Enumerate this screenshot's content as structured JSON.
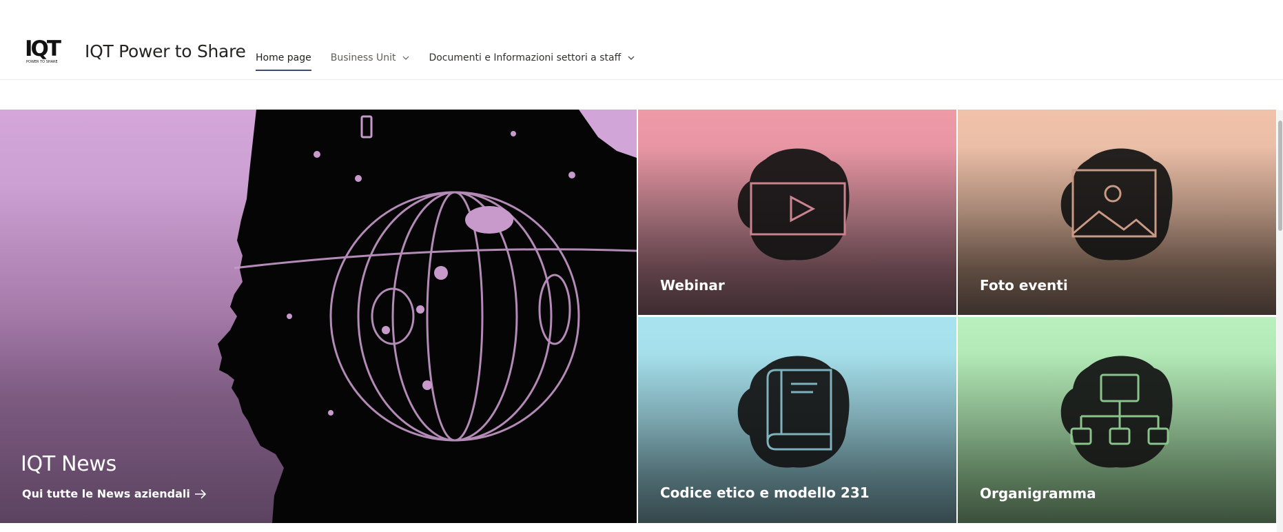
{
  "header": {
    "logo_text": "IQT",
    "logo_subtext": "POWER TO SHARE",
    "site_title": "IQT Power to Share",
    "nav": [
      {
        "label": "Home page"
      },
      {
        "label": "Business Unit"
      },
      {
        "label": "Documenti e Informazioni settori a staff"
      }
    ]
  },
  "hero": {
    "title": "IQT News",
    "link_label": "Qui tutte le News aziendali"
  },
  "tiles": [
    {
      "label": "Webinar",
      "icon": "video-play-icon",
      "accent": "#c9848f"
    },
    {
      "label": "Foto eventi",
      "icon": "image-icon",
      "accent": "#c89a85"
    },
    {
      "label": "Codice etico e modello 231",
      "icon": "book-icon",
      "accent": "#7fb2bd"
    },
    {
      "label": "Organigramma",
      "icon": "org-chart-icon",
      "accent": "#8ac48c"
    }
  ],
  "colors": {
    "nav_active_underline": "#3b4b6b",
    "hero_gradient_top": "#d4a6da",
    "webinar_top": "#ee9aa7",
    "foto_top": "#f1c2a9",
    "codice_top": "#a9e3ef",
    "organigramma_top": "#b9f0bd"
  }
}
